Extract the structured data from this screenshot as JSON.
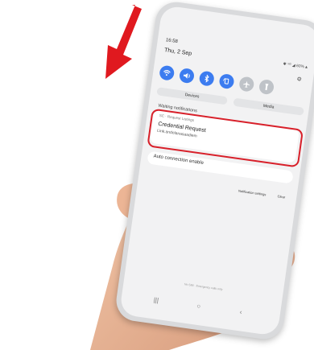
{
  "status_bar": {
    "time": "16:58",
    "indicators": "✱ ⁵ᴳ ◢ 60%▲"
  },
  "shade": {
    "date": "Thu, 2 Sep",
    "settings_icon": "gear-icon",
    "quick_toggles": [
      {
        "name": "wifi",
        "icon": "wifi-icon",
        "state": "on"
      },
      {
        "name": "sound",
        "icon": "volume-icon",
        "state": "on"
      },
      {
        "name": "bluetooth",
        "icon": "bluetooth-icon",
        "state": "on"
      },
      {
        "name": "auto-rotate",
        "icon": "rotate-icon",
        "state": "on"
      },
      {
        "name": "airplane",
        "icon": "airplane-icon",
        "state": "off"
      },
      {
        "name": "flashlight",
        "icon": "flashlight-icon",
        "state": "off"
      }
    ],
    "devices_label": "Devices",
    "media_label": "Media"
  },
  "notifications": {
    "section_label": "Waiting notifications",
    "card": {
      "app_name": "SC · Request Listings",
      "title": "Credential Request",
      "body": "Link.andolanasaadiem"
    },
    "second_card": "Auto connection enable",
    "actions": {
      "settings": "Notification settings",
      "clear": "Clear"
    }
  },
  "footer_note": "No SIM · Emergency calls only",
  "nav_buttons": {
    "recents": "|||",
    "home": "○",
    "back": "‹"
  },
  "colors": {
    "accent": "#3c7cf0",
    "highlight": "#d8202a",
    "arrow": "#e0191f"
  }
}
